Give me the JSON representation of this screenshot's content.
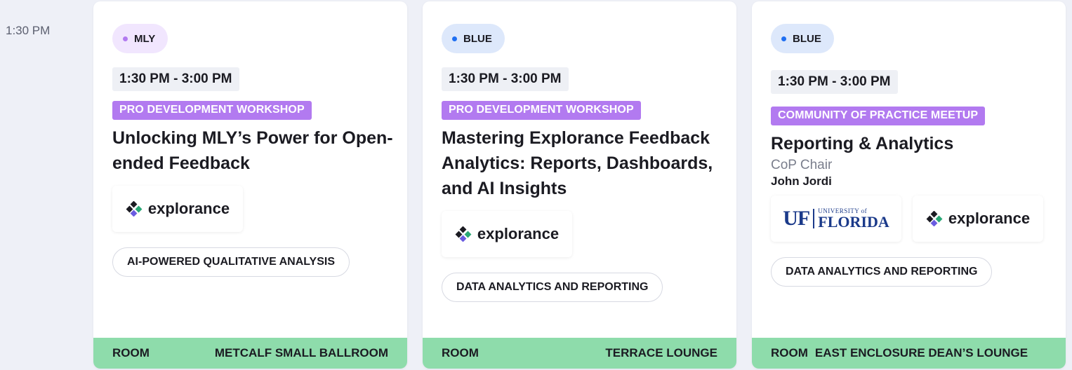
{
  "time_slot": "1:30 PM",
  "colors": {
    "mly_dot": "#b27af0",
    "mly_bg": "#f1e6fe",
    "blue_dot": "#1f6ff2",
    "blue_bg": "#dde8fb",
    "badge": "#b27af0",
    "room_bar": "#8edcab"
  },
  "sessions": [
    {
      "track": "MLY",
      "time": "1:30 PM - 3:00 PM",
      "type": "PRO DEVELOPMENT WORKSHOP",
      "title": "Unlocking MLY’s Power for Open-ended Feedback",
      "logos": [
        "explorance"
      ],
      "topic": "AI-POWERED QUALITATIVE ANALYSIS",
      "room_label": "ROOM",
      "room": "METCALF SMALL BALLROOM"
    },
    {
      "track": "BLUE",
      "time": "1:30 PM - 3:00 PM",
      "type": "PRO DEVELOPMENT WORKSHOP",
      "title": "Mastering Explorance Feedback Analytics: Reports, Dashboards, and AI Insights",
      "logos": [
        "explorance"
      ],
      "topic": "DATA ANALYTICS AND REPORTING",
      "room_label": "ROOM",
      "room": "TERRACE LOUNGE"
    },
    {
      "track": "BLUE",
      "time": "1:30 PM - 3:00 PM",
      "type": "COMMUNITY OF PRACTICE MEETUP",
      "title": "Reporting & Analytics",
      "role": "CoP Chair",
      "person": "John Jordi",
      "logos": [
        "university-of-florida",
        "explorance"
      ],
      "uf": {
        "short": "UF",
        "small": "UNIVERSITY of",
        "name": "FLORIDA"
      },
      "topic": "DATA ANALYTICS AND REPORTING",
      "room_label": "ROOM",
      "room": "EAST ENCLOSURE DEAN’S LOUNGE"
    }
  ],
  "logo_text": "explorance"
}
